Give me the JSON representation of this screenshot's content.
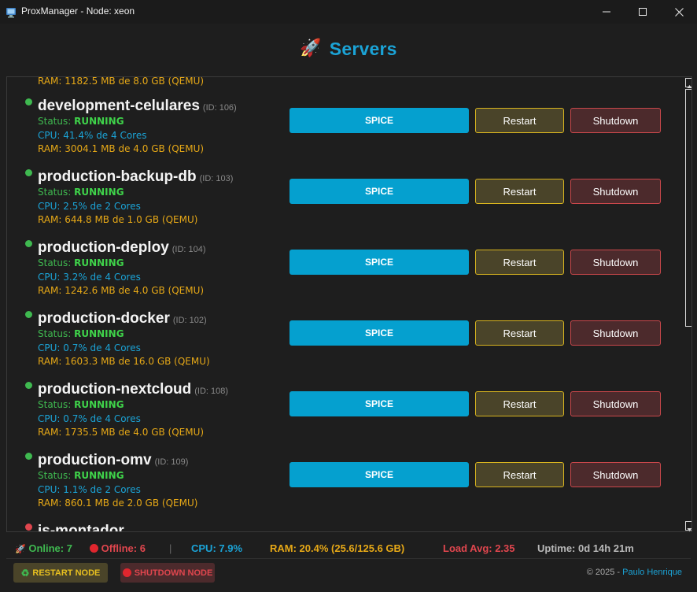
{
  "window": {
    "title": "ProxManager - Node: xeon"
  },
  "header": {
    "icon": "🚀",
    "title": "Servers"
  },
  "partial_top": {
    "ram": "RAM: 1182.5 MB de 8.0 GB (QEMU)"
  },
  "servers": [
    {
      "name": "development-celulares",
      "id": "(ID: 106)",
      "status_label": "Status: ",
      "status": "RUNNING",
      "cpu": "CPU: 41.4% de 4 Cores",
      "ram": "RAM: 3004.1 MB de 4.0 GB (QEMU)",
      "status_color": "#3fb950"
    },
    {
      "name": "production-backup-db",
      "id": "(ID: 103)",
      "status_label": "Status: ",
      "status": "RUNNING",
      "cpu": "CPU: 2.5% de 2 Cores",
      "ram": "RAM: 644.8 MB de 1.0 GB (QEMU)",
      "status_color": "#3fb950"
    },
    {
      "name": "production-deploy",
      "id": "(ID: 104)",
      "status_label": "Status: ",
      "status": "RUNNING",
      "cpu": "CPU: 3.2% de 4 Cores",
      "ram": "RAM: 1242.6 MB de 4.0 GB (QEMU)",
      "status_color": "#3fb950"
    },
    {
      "name": "production-docker",
      "id": "(ID: 102)",
      "status_label": "Status: ",
      "status": "RUNNING",
      "cpu": "CPU: 0.7% de 4 Cores",
      "ram": "RAM: 1603.3 MB de 16.0 GB (QEMU)",
      "status_color": "#3fb950"
    },
    {
      "name": "production-nextcloud",
      "id": "(ID: 108)",
      "status_label": "Status: ",
      "status": "RUNNING",
      "cpu": "CPU: 0.7% de 4 Cores",
      "ram": "RAM: 1735.5 MB de 4.0 GB (QEMU)",
      "status_color": "#3fb950"
    },
    {
      "name": "production-omv",
      "id": "(ID: 109)",
      "status_label": "Status: ",
      "status": "RUNNING",
      "cpu": "CPU: 1.1% de 2 Cores",
      "ram": "RAM: 860.1 MB de 2.0 GB (QEMU)",
      "status_color": "#3fb950"
    }
  ],
  "partial_bottom": {
    "name": "js-montador",
    "status_color": "#e0464e"
  },
  "buttons": {
    "spice": "SPICE",
    "restart": "Restart",
    "shutdown": "Shutdown"
  },
  "stats": {
    "online": "Online: 7",
    "offline": "Offline: 6",
    "separator": "|",
    "cpu": "CPU: 7.9%",
    "ram": "RAM: 20.4% (25.6/125.6 GB)",
    "load": "Load Avg: 2.35",
    "uptime": "Uptime: 0d 14h 21m"
  },
  "footer": {
    "restart_node": "RESTART NODE",
    "shutdown_node": "SHUTDOWN NODE",
    "copyright": "© 2025 - ",
    "author": "Paulo Henrique"
  },
  "colors": {
    "accent": "#1ba3d6",
    "running": "#3fb950",
    "cpu": "#1ba3d6",
    "ram": "#e6a817",
    "load": "#e0464e",
    "restart_border": "#d8b41f",
    "shutdown_border": "#c9474b"
  }
}
